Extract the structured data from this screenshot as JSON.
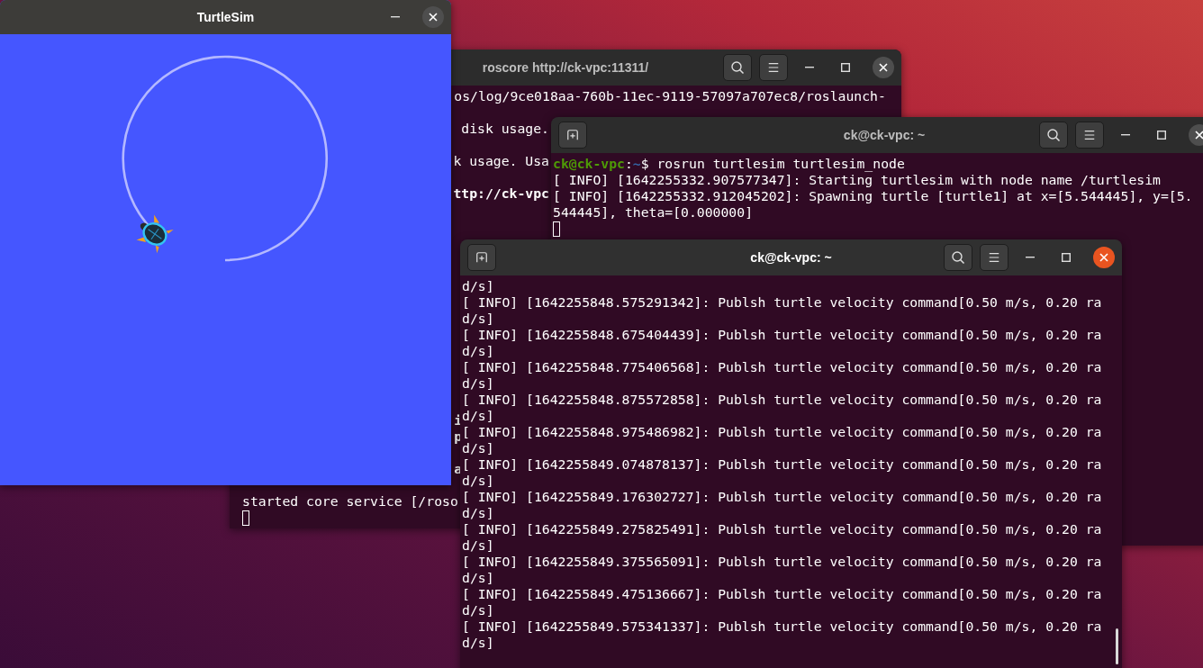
{
  "roscore_window": {
    "title": "roscore http://ck-vpc:11311/",
    "focused": false,
    "cursor": true,
    "lines": [
      {
        "text": "os/log/9ce018aa-760b-11ec-9119-57097a707ec8/roslaunch-",
        "bold": false
      },
      {
        "text": "disk usage.",
        "bold": false
      },
      {
        "text": "k usage. Usa",
        "bold": false
      },
      {
        "text": "ttp://ck-vpc",
        "bold": true
      },
      {
        "text": "i",
        "bold": true
      },
      {
        "text": "p",
        "bold": true
      },
      {
        "text": "a",
        "bold": true
      },
      {
        "text": "started core service [/roso",
        "bold": false
      }
    ]
  },
  "turtlesim_window": {
    "title": "TurtleSim"
  },
  "terminal_1": {
    "title": "ck@ck-vpc: ~",
    "focused": false,
    "cursor": true,
    "prompt": {
      "user_host": "ck@ck-vpc",
      "separator": ":",
      "path": "~",
      "command": "$ rosrun turtlesim turtlesim_node"
    },
    "lines": [
      "[ INFO] [1642255332.907577347]: Starting turtlesim with node name /turtlesim",
      "[ INFO] [1642255332.912045202]: Spawning turtle [turtle1] at x=[5.544445], y=[5.",
      "544445], theta=[0.000000]"
    ]
  },
  "terminal_2": {
    "title": "ck@ck-vpc: ~",
    "focused": true,
    "lines": [
      "d/s]",
      "[ INFO] [1642255848.575291342]: Publsh turtle velocity command[0.50 m/s, 0.20 ra",
      "d/s]",
      "[ INFO] [1642255848.675404439]: Publsh turtle velocity command[0.50 m/s, 0.20 ra",
      "d/s]",
      "[ INFO] [1642255848.775406568]: Publsh turtle velocity command[0.50 m/s, 0.20 ra",
      "d/s]",
      "[ INFO] [1642255848.875572858]: Publsh turtle velocity command[0.50 m/s, 0.20 ra",
      "d/s]",
      "[ INFO] [1642255848.975486982]: Publsh turtle velocity command[0.50 m/s, 0.20 ra",
      "d/s]",
      "[ INFO] [1642255849.074878137]: Publsh turtle velocity command[0.50 m/s, 0.20 ra",
      "d/s]",
      "[ INFO] [1642255849.176302727]: Publsh turtle velocity command[0.50 m/s, 0.20 ra",
      "d/s]",
      "[ INFO] [1642255849.275825491]: Publsh turtle velocity command[0.50 m/s, 0.20 ra",
      "d/s]",
      "[ INFO] [1642255849.375565091]: Publsh turtle velocity command[0.50 m/s, 0.20 ra",
      "d/s]",
      "[ INFO] [1642255849.475136667]: Publsh turtle velocity command[0.50 m/s, 0.20 ra",
      "d/s]",
      "[ INFO] [1642255849.575341337]: Publsh turtle velocity command[0.50 m/s, 0.20 ra",
      "d/s]"
    ]
  }
}
